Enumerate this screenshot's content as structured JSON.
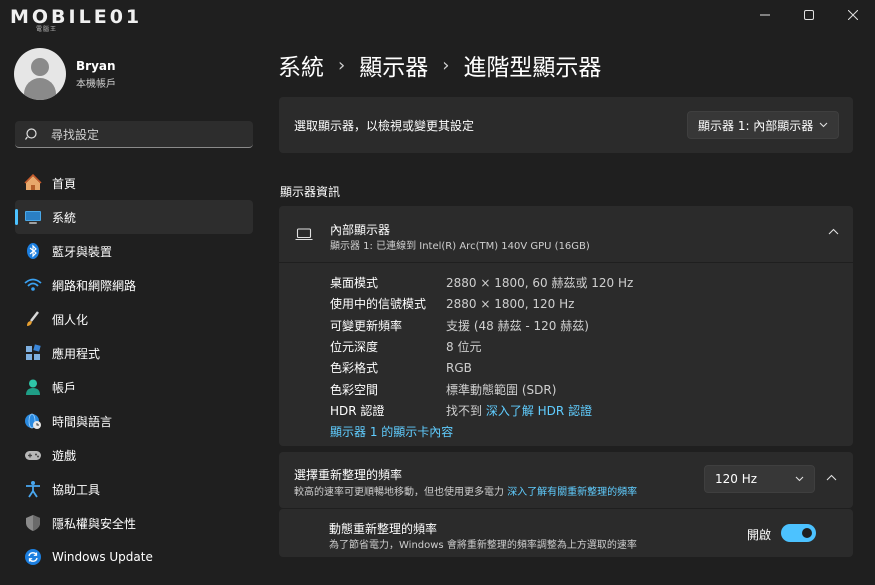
{
  "window": {
    "logo_text": "MOBILE01",
    "logo_sub": "電腦王",
    "controls": [
      "minimize",
      "maximize",
      "close"
    ]
  },
  "profile": {
    "name": "Bryan",
    "account_type": "本機帳戶"
  },
  "search": {
    "placeholder": "尋找設定"
  },
  "sidebar": {
    "items": [
      {
        "label": "首頁",
        "icon": "home-icon",
        "active": false
      },
      {
        "label": "系統",
        "icon": "system-icon",
        "active": true
      },
      {
        "label": "藍牙與裝置",
        "icon": "bluetooth-icon",
        "active": false
      },
      {
        "label": "網路和網際網路",
        "icon": "wifi-icon",
        "active": false
      },
      {
        "label": "個人化",
        "icon": "brush-icon",
        "active": false
      },
      {
        "label": "應用程式",
        "icon": "apps-icon",
        "active": false
      },
      {
        "label": "帳戶",
        "icon": "person-icon",
        "active": false
      },
      {
        "label": "時間與語言",
        "icon": "globe-clock-icon",
        "active": false
      },
      {
        "label": "遊戲",
        "icon": "gamepad-icon",
        "active": false
      },
      {
        "label": "協助工具",
        "icon": "accessibility-icon",
        "active": false
      },
      {
        "label": "隱私權與安全性",
        "icon": "shield-icon",
        "active": false
      },
      {
        "label": "Windows Update",
        "icon": "update-icon",
        "active": false
      }
    ]
  },
  "breadcrumb": {
    "items": [
      "系統",
      "顯示器",
      "進階型顯示器"
    ],
    "separator": "›"
  },
  "display_select": {
    "label": "選取顯示器，以檢視或變更其設定",
    "selected": "顯示器 1: 內部顯示器"
  },
  "display_info": {
    "section_title": "顯示器資訊",
    "title": "內部顯示器",
    "subtitle": "顯示器 1: 已連線到 Intel(R) Arc(TM) 140V GPU (16GB)",
    "rows": [
      {
        "key": "桌面模式",
        "value": "2880 × 1800, 60 赫茲或 120 Hz"
      },
      {
        "key": "使用中的信號模式",
        "value": "2880 × 1800, 120 Hz"
      },
      {
        "key": "可變更新頻率",
        "value": "支援 (48 赫茲 - 120 赫茲)"
      },
      {
        "key": "位元深度",
        "value": "8 位元"
      },
      {
        "key": "色彩格式",
        "value": "RGB"
      },
      {
        "key": "色彩空間",
        "value": "標準動態範圍 (SDR)"
      },
      {
        "key": "HDR 認證",
        "value": "找不到",
        "link": "深入了解 HDR 認證"
      }
    ],
    "adapter_link": "顯示器 1 的顯示卡內容"
  },
  "refresh_rate": {
    "title": "選擇重新整理的頻率",
    "subtitle": "較高的速率可更順暢地移動，但也使用更多電力",
    "link": "深入了解有關重新整理的頻率",
    "selected": "120 Hz"
  },
  "dynamic_refresh": {
    "title": "動態重新整理的頻率",
    "subtitle": "為了節省電力，Windows 會將重新整理的頻率調整為上方選取的速率",
    "toggle_label": "開啟",
    "toggle_on": true
  },
  "colors": {
    "accent": "#4cc2ff",
    "link": "#60cdff",
    "background": "#1f1f1f",
    "card": "#2b2b2b"
  }
}
